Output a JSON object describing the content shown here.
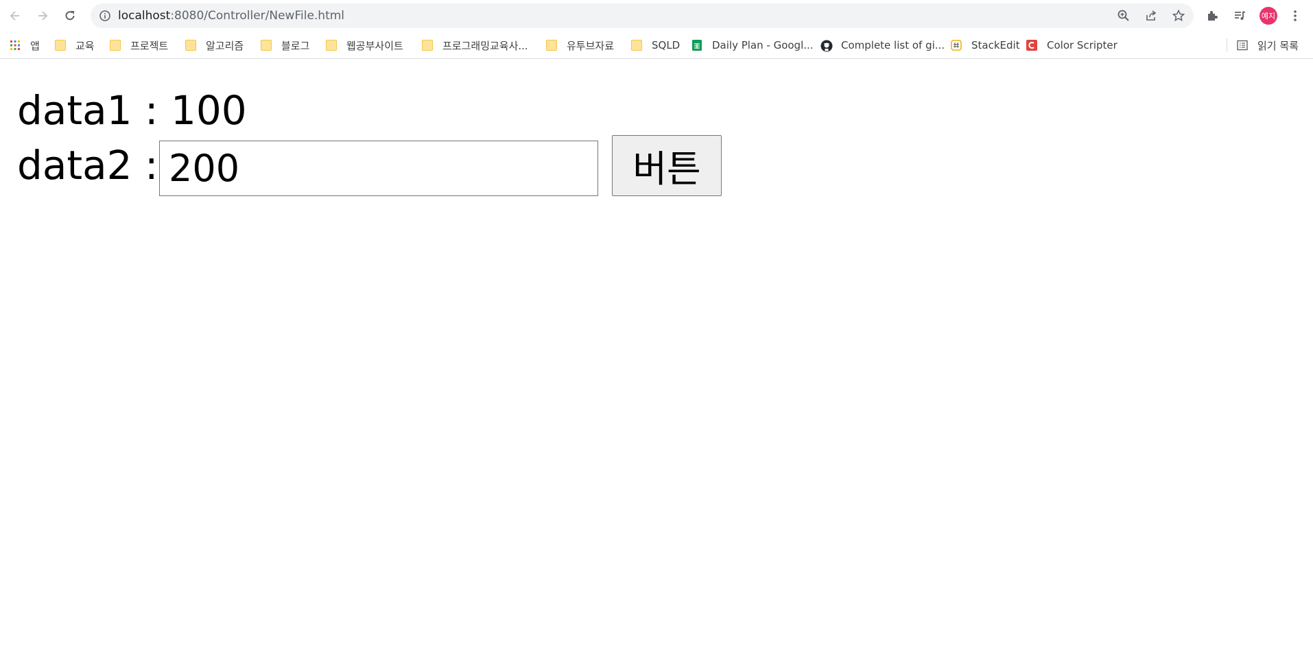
{
  "browser": {
    "url_host": "localhost",
    "url_rest": ":8080/Controller/NewFile.html",
    "profile_label": "예지",
    "icons": [
      "back-icon",
      "forward-icon",
      "reload-icon",
      "info-icon",
      "zoom-icon",
      "share-icon",
      "star-icon",
      "extensions-icon",
      "media-icon",
      "menu-icon"
    ]
  },
  "bookmarks": {
    "items": [
      {
        "label": "앱",
        "icon": "apps-icon"
      },
      {
        "label": "교육",
        "icon": "folder-icon"
      },
      {
        "label": "프로젝트",
        "icon": "folder-icon"
      },
      {
        "label": "알고리즘",
        "icon": "folder-icon"
      },
      {
        "label": "블로그",
        "icon": "folder-icon"
      },
      {
        "label": "웹공부사이트",
        "icon": "folder-icon"
      },
      {
        "label": "프로그래밍교육사...",
        "icon": "folder-icon"
      },
      {
        "label": "유투브자료",
        "icon": "folder-icon"
      },
      {
        "label": "SQLD",
        "icon": "folder-icon"
      },
      {
        "label": "Daily Plan - Googl...",
        "icon": "sheets-icon"
      },
      {
        "label": "Complete list of gi...",
        "icon": "github-icon"
      },
      {
        "label": "StackEdit",
        "icon": "stackedit-icon"
      },
      {
        "label": "Color Scripter",
        "icon": "colorscripter-icon"
      }
    ],
    "reading_list": "읽기 목록"
  },
  "page": {
    "data1_label": "data1 : 100",
    "data2_label": "data2 :",
    "data2_value": "200",
    "button_label": "버튼"
  },
  "colors": {
    "avatar": "#e8336d",
    "folder": "#ffe39a"
  }
}
